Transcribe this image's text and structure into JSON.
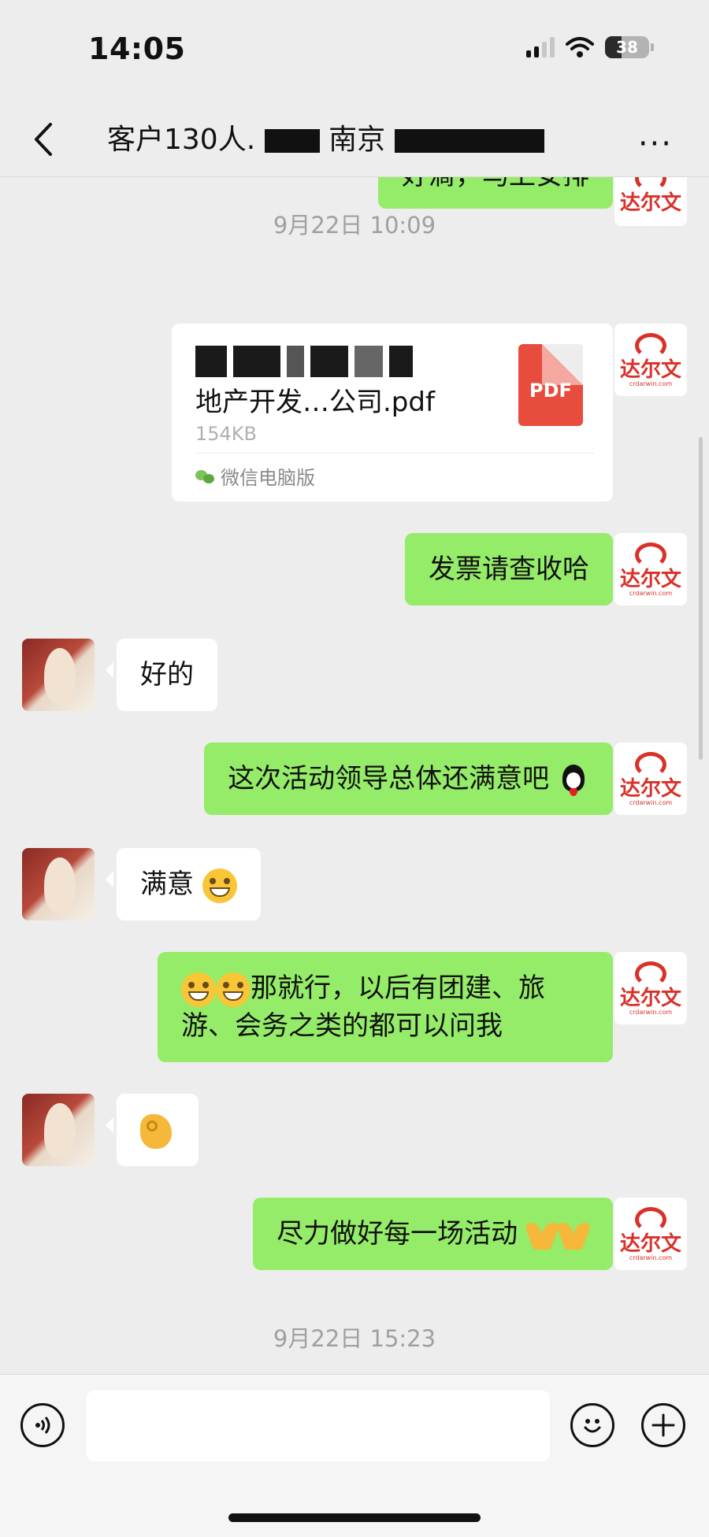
{
  "status_bar": {
    "time": "14:05",
    "battery": "38",
    "battery_level": 0.38
  },
  "nav": {
    "title_prefix": "客户130人.",
    "title_mid": "南京",
    "more_label": "···"
  },
  "messages": {
    "top_partial_text": "好滴，马上安排",
    "ts1": "9月22日 10:09",
    "file": {
      "name": "地产开发…公司.pdf",
      "size": "154KB",
      "type_label": "PDF",
      "source": "微信电脑版"
    },
    "m_invoice": "发票请查收哈",
    "m_ok": "好的",
    "m_satisfied_q": "这次活动领导总体还满意吧",
    "m_satisfied": "满意",
    "m_followup": "那就行，以后有团建、旅游、会务之类的都可以问我",
    "m_best": "尽力做好每一场活动",
    "ts2": "9月22日 15:23"
  },
  "avatars": {
    "mine_logo_text": "达尔文",
    "mine_logo_sub": "crdarwin.com"
  },
  "icons": {
    "back": "chevron-left-icon",
    "more": "more-dots-icon",
    "voice": "voice-icon",
    "emoji": "emoji-icon",
    "plus": "plus-icon"
  },
  "colors": {
    "mine_bubble": "#95ec69",
    "other_bubble": "#ffffff",
    "background": "#ededed",
    "logo_red": "#d9302a"
  }
}
